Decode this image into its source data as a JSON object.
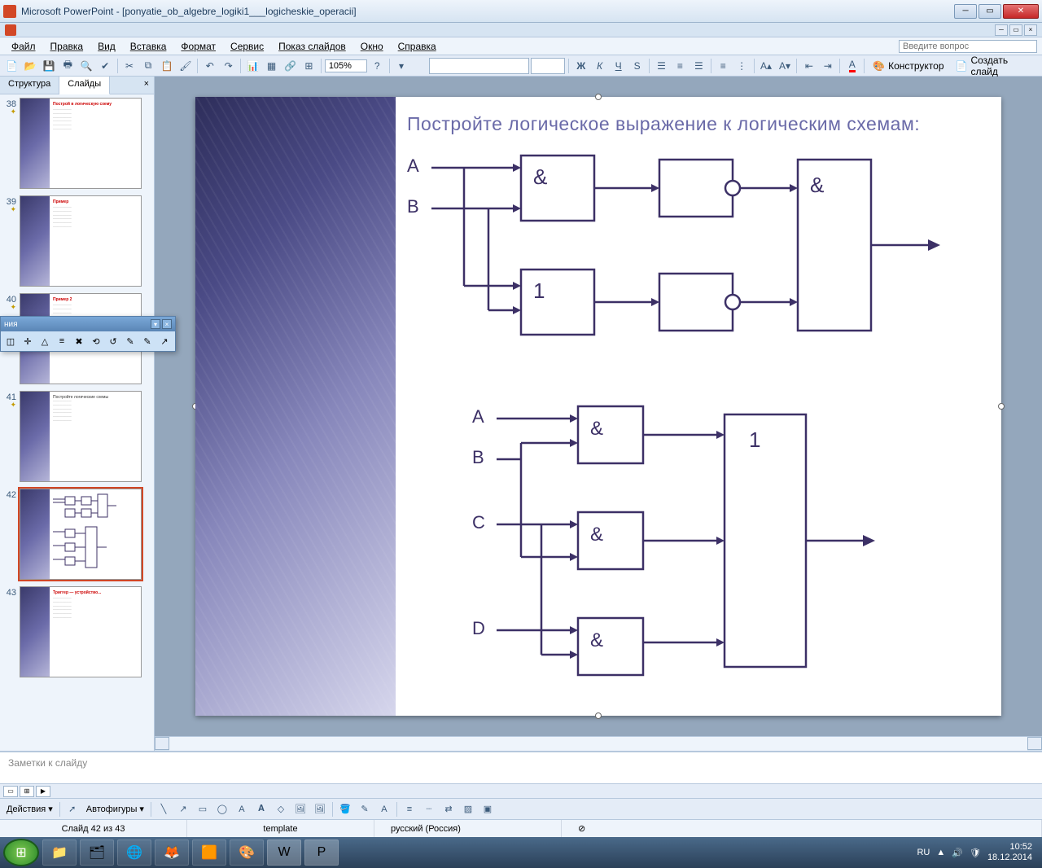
{
  "titlebar": {
    "text": "Microsoft PowerPoint - [ponyatie_ob_algebre_logiki1___logicheskie_operacii]"
  },
  "menubar": {
    "items": [
      "Файл",
      "Правка",
      "Вид",
      "Вставка",
      "Формат",
      "Сервис",
      "Показ слайдов",
      "Окно",
      "Справка"
    ],
    "help_placeholder": "Введите вопрос"
  },
  "toolbar": {
    "zoom": "105%",
    "designer": "Конструктор",
    "new_slide": "Создать слайд"
  },
  "side": {
    "tab_outline": "Структура",
    "tab_slides": "Слайды",
    "thumbs": [
      {
        "n": "38",
        "star": true,
        "title_red": "Построй в логическую схему",
        "selected": false
      },
      {
        "n": "39",
        "star": true,
        "title_red": "Пример",
        "selected": false
      },
      {
        "n": "40",
        "star": true,
        "title_red": "Пример 2",
        "selected": false
      },
      {
        "n": "41",
        "star": true,
        "title": "Постройте логические схемы",
        "selected": false
      },
      {
        "n": "42",
        "star": false,
        "diagram": true,
        "selected": true
      },
      {
        "n": "43",
        "star": false,
        "title_red": "Триггер — устройство...",
        "selected": false
      }
    ]
  },
  "floating_toolbar": {
    "title": "ния"
  },
  "slide": {
    "title": "Постройте логическое выражение к логическим схемам:",
    "schema1": {
      "labels": {
        "A": "A",
        "B": "B",
        "and": "&",
        "or": "1"
      }
    },
    "schema2": {
      "labels": {
        "A": "A",
        "B": "B",
        "C": "C",
        "D": "D",
        "and": "&",
        "or": "1"
      }
    }
  },
  "notes": {
    "placeholder": "Заметки к слайду"
  },
  "drawbar": {
    "actions": "Действия",
    "autoshapes": "Автофигуры"
  },
  "statusbar": {
    "slide": "Слайд 42 из 43",
    "template": "template",
    "lang": "русский (Россия)"
  },
  "taskbar": {
    "lang": "RU",
    "time": "10:52",
    "date": "18.12.2014"
  }
}
